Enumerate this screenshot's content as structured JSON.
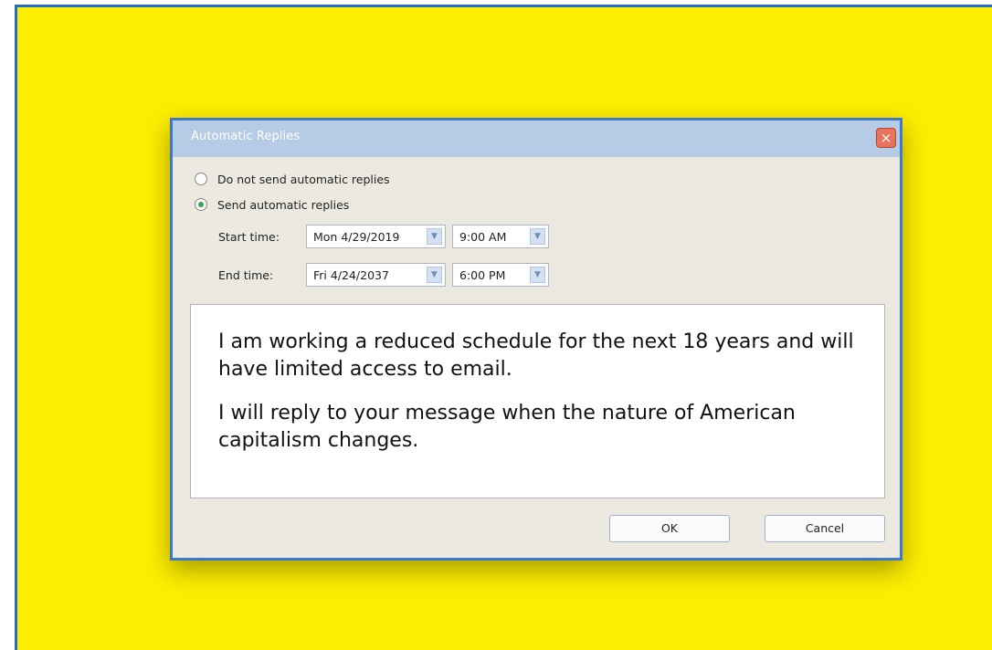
{
  "dialog": {
    "title": "Automatic Replies",
    "close_glyph": "×",
    "options": [
      {
        "label": "Do not send automatic replies",
        "checked": false
      },
      {
        "label": "Send automatic replies",
        "checked": true
      }
    ],
    "start_time": {
      "label": "Start time:",
      "date": "Mon 4/29/2019",
      "time": "9:00 AM"
    },
    "end_time": {
      "label": "End time:",
      "date": "Fri 4/24/2037",
      "time": "6:00 PM"
    },
    "message": [
      "I am working a reduced schedule for the next 18 years and will have limited access to email.",
      "I will reply to your message when the nature of American capitalism changes."
    ],
    "ok_label": "OK",
    "cancel_label": "Cancel",
    "dropdown_glyph": "▼"
  },
  "colors": {
    "background": "#fdee00",
    "frame_border": "#1f6fc4",
    "dialog_border": "#3f77c9",
    "titlebar": "#b6cbe6",
    "close_button": "#e8735f",
    "radio_selected": "#3c9f52"
  }
}
